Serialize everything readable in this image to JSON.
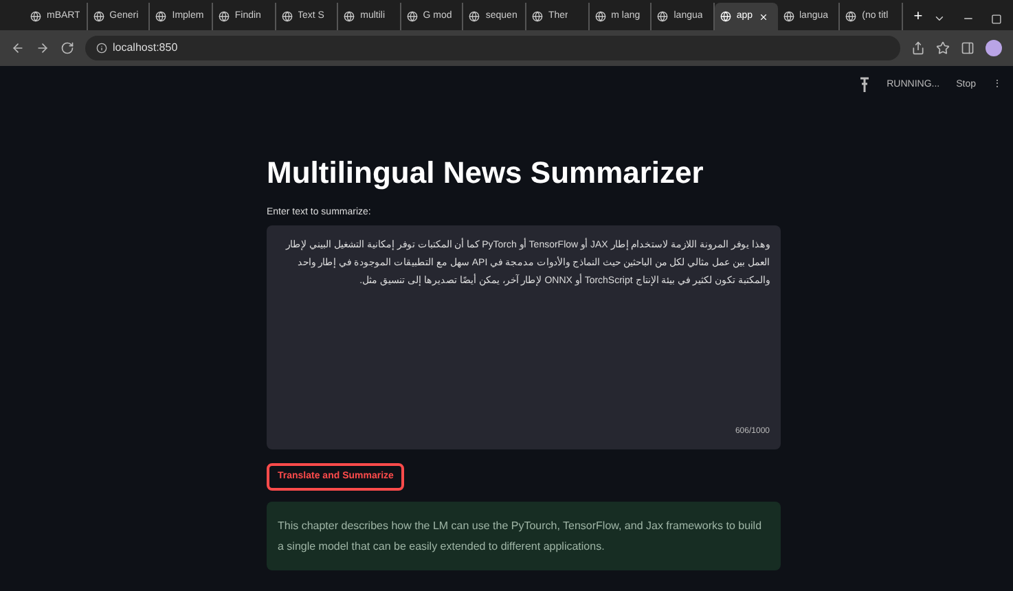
{
  "browser": {
    "tabs": [
      {
        "title": "mBART",
        "selected": false
      },
      {
        "title": "Generi",
        "selected": false
      },
      {
        "title": "Implem",
        "selected": false
      },
      {
        "title": "Findin",
        "selected": false
      },
      {
        "title": "Text S",
        "selected": false
      },
      {
        "title": "multili",
        "selected": false
      },
      {
        "title": "G mod",
        "selected": false
      },
      {
        "title": "sequen",
        "selected": false
      },
      {
        "title": "Ther",
        "selected": false
      },
      {
        "title": "m lang",
        "selected": false
      },
      {
        "title": "langua",
        "selected": false
      },
      {
        "title": "app",
        "selected": true
      },
      {
        "title": "langua",
        "selected": false
      },
      {
        "title": "(no titl",
        "selected": false
      }
    ],
    "new_tab": "+",
    "address": "localhost:850"
  },
  "app_header": {
    "status": "RUNNING...",
    "stop": "Stop",
    "menu": "⋮"
  },
  "title": "Multilingual News Summarizer",
  "input": {
    "label": "Enter text to summarize:",
    "value": "وهذا يوفر المرونة اللازمة لاستخدام إطار JAX أو TensorFlow أو PyTorch كما أن المكتبات توفر إمكانية التشغيل البيني لإطار العمل بين عمل مثالي لكل من الباحثين حيث النماذج والأدوات مدمجة في API سهل مع التطبيقات الموجودة في إطار واحد والمكتبة تكون لكثير في بيئة الإنتاج TorchScript أو ONNX لإطار آخر، يمكن أيضًا تصديرها إلى تنسيق مثل.",
    "counter": "606/1000"
  },
  "button": "Translate and Summarize",
  "result": "This chapter describes how the LM can use the PyTourch, TensorFlow, and Jax frameworks to build a single model that can be easily extended to different applications."
}
